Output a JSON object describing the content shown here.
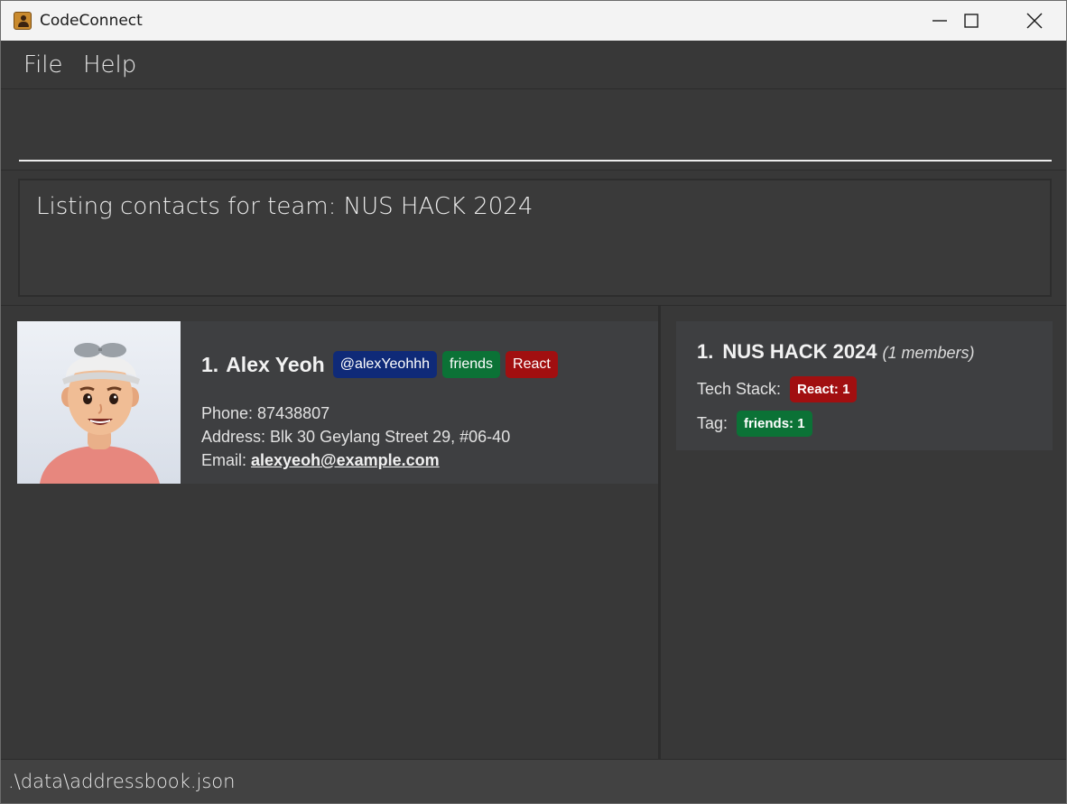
{
  "window": {
    "title": "CodeConnect"
  },
  "menu": {
    "file": "File",
    "help": "Help"
  },
  "command": {
    "value": ""
  },
  "result": {
    "message": "Listing contacts for team: NUS HACK 2024"
  },
  "persons": [
    {
      "index": "1.",
      "name": "Alex Yeoh",
      "handle": "@alexYeohhh",
      "tags": [
        "friends",
        "React"
      ],
      "phone": "Phone: 87438807",
      "address": "Address: Blk 30 Geylang Street 29, #06-40",
      "email_label": "Email: ",
      "email": "alexyeoh@example.com"
    }
  ],
  "teams": [
    {
      "index": "1.",
      "name": "NUS HACK 2024",
      "members": "(1 members)",
      "tech_stack_label": "Tech Stack:",
      "tech_stack": [
        "React: 1"
      ],
      "tag_label": "Tag:",
      "tags": [
        "friends: 1"
      ]
    }
  ],
  "status": {
    "path": ".\\data\\addressbook.json"
  },
  "colors": {
    "handle_tag": "#0f2a78",
    "friends_tag": "#0b7236",
    "react_tag": "#a10f10",
    "background": "#383838",
    "card": "#3e3f41"
  },
  "icons": {
    "app": "contact-book-icon",
    "minimize": "minimize-icon",
    "maximize": "maximize-icon",
    "close": "close-icon"
  }
}
